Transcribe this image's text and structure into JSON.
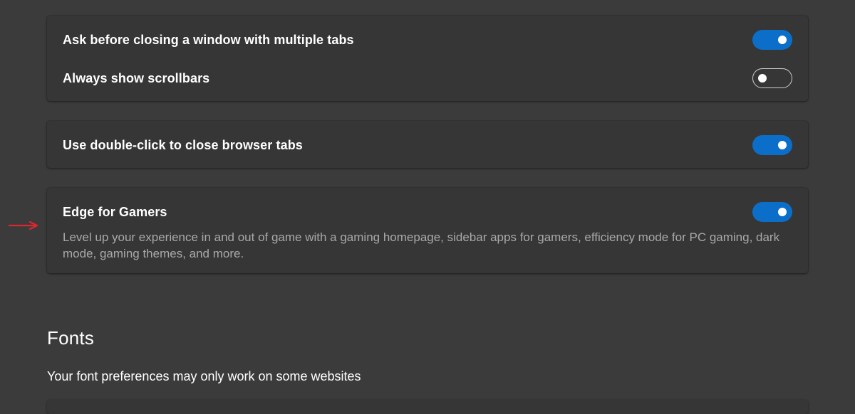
{
  "settings": {
    "ask_before_closing": {
      "label": "Ask before closing a window with multiple tabs",
      "enabled": true
    },
    "always_show_scrollbars": {
      "label": "Always show scrollbars",
      "enabled": false
    },
    "double_click_close": {
      "label": "Use double-click to close browser tabs",
      "enabled": true
    },
    "edge_for_gamers": {
      "label": "Edge for Gamers",
      "description": "Level up your experience in and out of game with a gaming homepage, sidebar apps for gamers, efficiency mode for PC gaming, dark mode, gaming themes, and more.",
      "enabled": true
    }
  },
  "fonts_section": {
    "title": "Fonts",
    "subtitle": "Your font preferences may only work on some websites"
  },
  "colors": {
    "background": "#3b3b3b",
    "card": "#363636",
    "toggle_on": "#0b6fc9",
    "annotation_arrow": "#e0262d"
  },
  "icons": {
    "annotation": "red-arrow-right-icon"
  }
}
